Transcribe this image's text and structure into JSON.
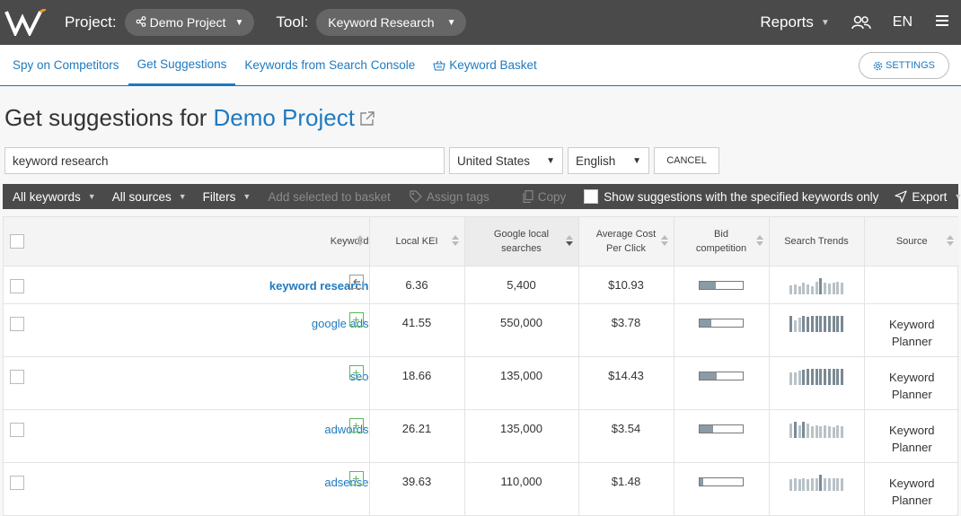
{
  "topbar": {
    "project_label": "Project:",
    "project_value": "Demo Project",
    "tool_label": "Tool:",
    "tool_value": "Keyword Research",
    "reports_label": "Reports",
    "language": "EN"
  },
  "subnav": {
    "tabs": [
      {
        "label": "Spy on Competitors"
      },
      {
        "label": "Get Suggestions"
      },
      {
        "label": "Keywords from Search Console"
      },
      {
        "label": "Keyword Basket"
      }
    ],
    "settings_label": "SETTINGS"
  },
  "heading": {
    "prefix": "Get suggestions for",
    "project": "Demo Project"
  },
  "search": {
    "query": "keyword research",
    "country": "United States",
    "language": "English",
    "cancel_label": "CANCEL"
  },
  "toolbar": {
    "all_keywords": "All keywords",
    "all_sources": "All sources",
    "filters": "Filters",
    "add_to_basket": "Add selected to basket",
    "assign_tags": "Assign tags",
    "copy": "Copy",
    "show_specified": "Show suggestions with the specified keywords only",
    "export": "Export"
  },
  "table": {
    "headers": {
      "keyword": "Keyword",
      "local_kei": "Local KEI",
      "google_local_searches": "Google local searches",
      "avg_cpc": "Average Cost Per Click",
      "bid_competition": "Bid competition",
      "search_trends": "Search Trends",
      "source": "Source"
    },
    "rows": [
      {
        "keyword": "keyword research",
        "kei": "6.36",
        "searches": "5,400",
        "cpc": "$10.93",
        "bid": 0.38,
        "source": "",
        "trend": [
          0.55,
          0.6,
          0.5,
          0.7,
          0.6,
          0.5,
          0.75,
          1.0,
          0.7,
          0.65,
          0.7,
          0.75,
          0.7
        ]
      },
      {
        "keyword": "google ads",
        "kei": "41.55",
        "searches": "550,000",
        "cpc": "$3.78",
        "bid": 0.28,
        "source": "Keyword Planner",
        "trend": [
          1.0,
          0.7,
          0.9,
          1.0,
          0.95,
          1.0,
          1.0,
          1.0,
          1.0,
          1.0,
          1.0,
          1.0,
          1.0
        ]
      },
      {
        "keyword": "seo",
        "kei": "18.66",
        "searches": "135,000",
        "cpc": "$14.43",
        "bid": 0.4,
        "source": "Keyword Planner",
        "trend": [
          0.75,
          0.8,
          0.9,
          0.95,
          1.0,
          1.0,
          1.0,
          1.0,
          1.0,
          1.0,
          1.0,
          1.0,
          1.0
        ]
      },
      {
        "keyword": "adwords",
        "kei": "26.21",
        "searches": "135,000",
        "cpc": "$3.54",
        "bid": 0.32,
        "source": "Keyword Planner",
        "trend": [
          0.9,
          1.0,
          0.75,
          1.0,
          0.9,
          0.7,
          0.75,
          0.7,
          0.75,
          0.7,
          0.65,
          0.75,
          0.7
        ]
      },
      {
        "keyword": "adsense",
        "kei": "39.63",
        "searches": "110,000",
        "cpc": "$1.48",
        "bid": 0.08,
        "source": "Keyword Planner",
        "trend": [
          0.7,
          0.75,
          0.7,
          0.75,
          0.7,
          0.75,
          0.8,
          1.0,
          0.75,
          0.8,
          0.75,
          0.8,
          0.75
        ]
      }
    ]
  },
  "colors": {
    "accent": "#1f7ac0",
    "topbar": "#4a4a4a",
    "add_green": "#5cb85c"
  }
}
